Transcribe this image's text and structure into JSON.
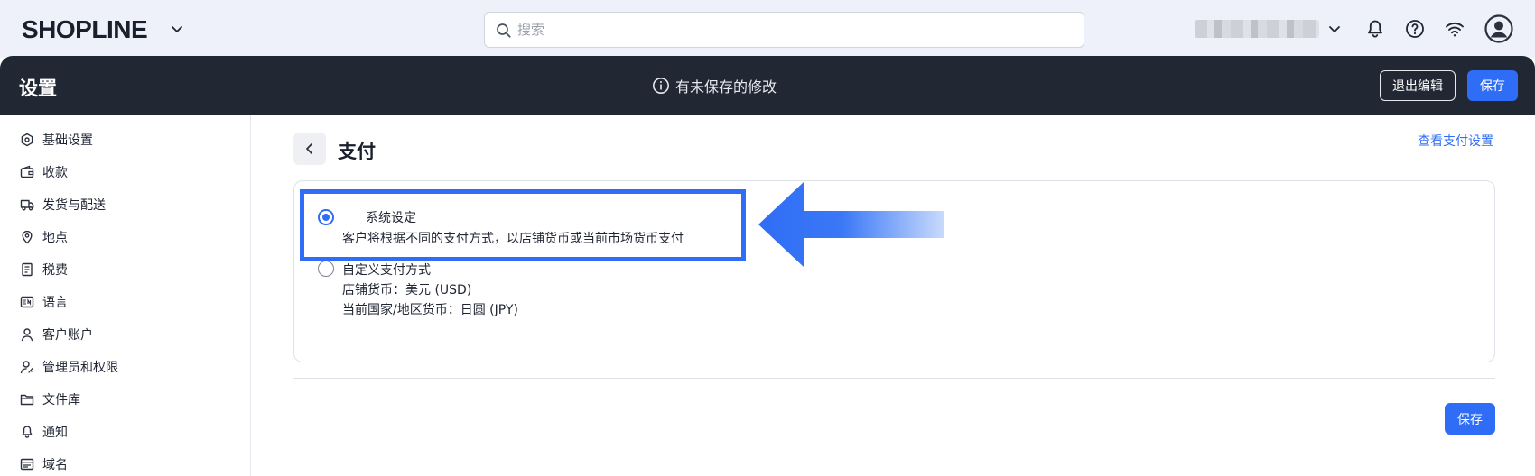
{
  "brand": {
    "logo_text": "SHOPLINE"
  },
  "search": {
    "placeholder": "搜索"
  },
  "icons": {
    "logo_menu": "chevron-down-icon",
    "search": "search-icon",
    "account_menu": "chevron-down-icon",
    "notifications": "bell-icon",
    "help": "help-icon",
    "status": "wifi-icon",
    "account": "user-avatar-icon"
  },
  "header": {
    "title": "设置",
    "unsaved_notice": "有未保存的修改",
    "exit_label": "退出编辑",
    "save_label": "保存"
  },
  "sidebar": {
    "items": [
      {
        "label": "基础设置",
        "icon": "settings-hexagon-icon"
      },
      {
        "label": "收款",
        "icon": "wallet-icon"
      },
      {
        "label": "发货与配送",
        "icon": "truck-icon"
      },
      {
        "label": "地点",
        "icon": "location-pin-icon"
      },
      {
        "label": "税费",
        "icon": "receipt-icon"
      },
      {
        "label": "语言",
        "icon": "language-icon"
      },
      {
        "label": "客户账户",
        "icon": "user-icon"
      },
      {
        "label": "管理员和权限",
        "icon": "user-key-icon"
      },
      {
        "label": "文件库",
        "icon": "folder-icon"
      },
      {
        "label": "通知",
        "icon": "bell-icon"
      },
      {
        "label": "域名",
        "icon": "domain-icon"
      }
    ]
  },
  "page": {
    "title": "支付",
    "view_link": "查看支付设置",
    "options": [
      {
        "label": "系统设定",
        "description": "客户将根据不同的支付方式，以店铺货币或当前市场货币支付",
        "selected": true
      },
      {
        "label": "自定义支付方式",
        "lines": [
          "店铺货币：美元 (USD)",
          "当前国家/地区货币：日圆 (JPY)"
        ],
        "selected": false
      }
    ],
    "save_label": "保存"
  },
  "colors": {
    "accent": "#2f6df6",
    "dark_header": "#222833",
    "top_bar": "#eef1fa",
    "text": "#1f2533"
  }
}
